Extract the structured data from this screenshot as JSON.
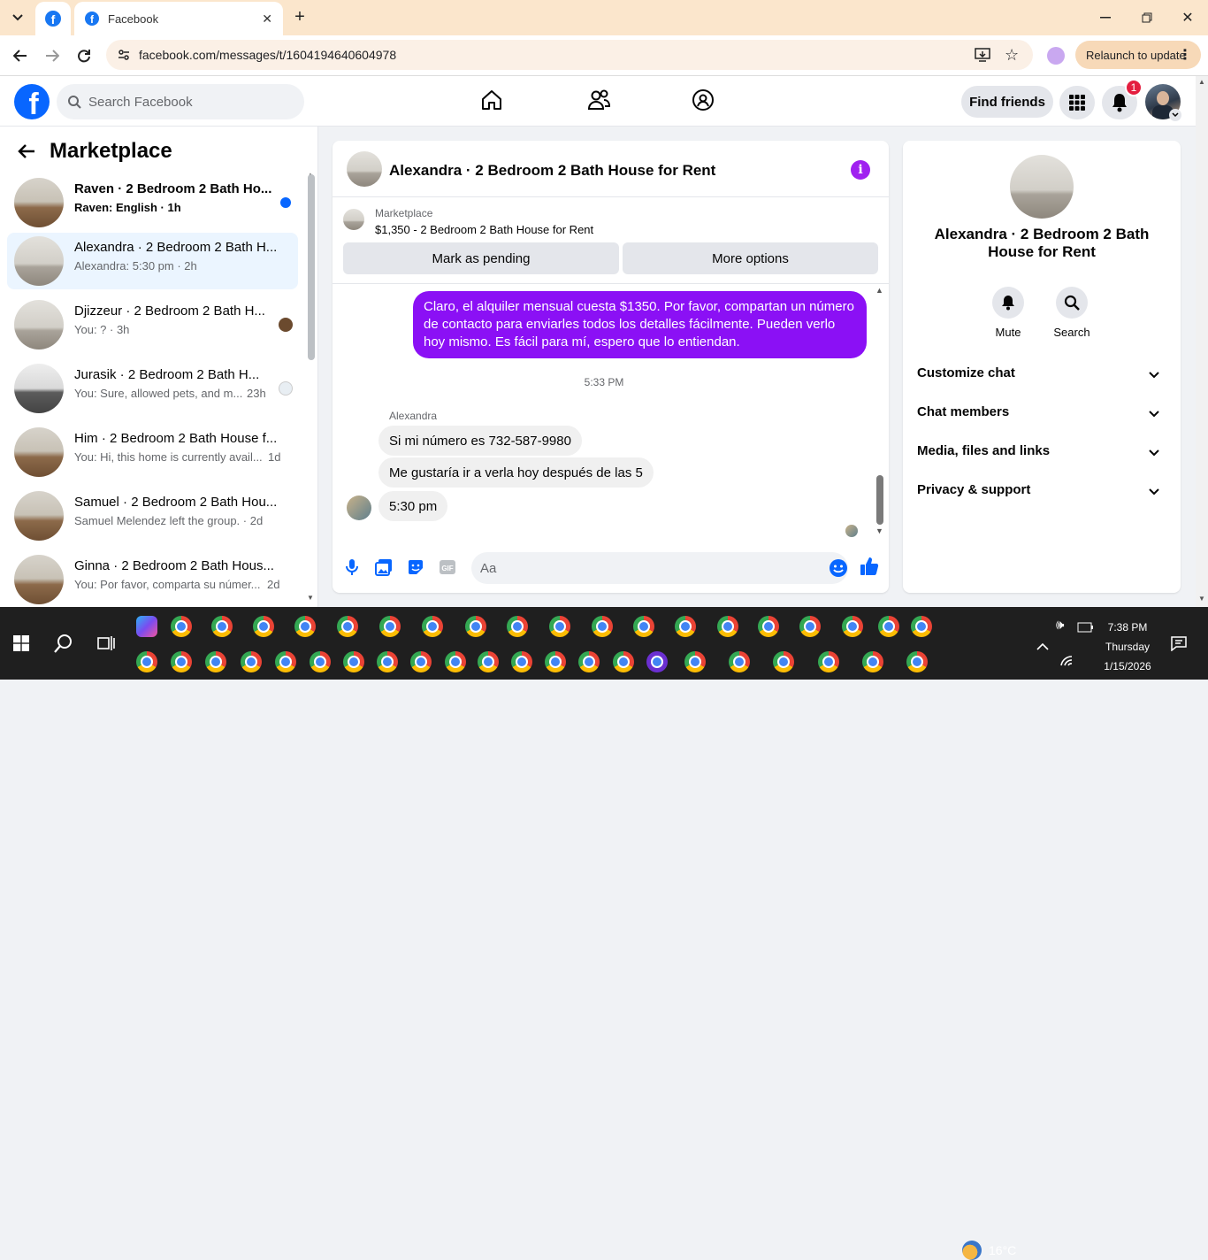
{
  "browser": {
    "tab_title": "Facebook",
    "url": "facebook.com/messages/t/1604194640604978",
    "relaunch_label": "Relaunch to update"
  },
  "header": {
    "search_placeholder": "Search Facebook",
    "find_friends": "Find friends",
    "notification_count": "1"
  },
  "sidebar": {
    "title": "Marketplace",
    "conversations": [
      {
        "name": "Raven · 2 Bedroom 2 Bath Ho...",
        "sub": "Raven: English · 1h",
        "unread": true
      },
      {
        "name": "Alexandra · 2 Bedroom 2 Bath H...",
        "sub": "Alexandra: 5:30 pm · 2h",
        "active": true
      },
      {
        "name": "Djizzeur · 2 Bedroom 2 Bath H...",
        "sub": "You: ? · 3h"
      },
      {
        "name": "Jurasik · 2 Bedroom 2 Bath H...",
        "sub": "You: Sure, allowed pets, and m...",
        "time": "23h"
      },
      {
        "name": "Him · 2 Bedroom 2 Bath House f...",
        "sub": "You: Hi, this home is currently avail...",
        "time": "1d"
      },
      {
        "name": "Samuel · 2 Bedroom 2 Bath Hou...",
        "sub": "Samuel Melendez left the group. · 2d"
      },
      {
        "name": "Ginna · 2 Bedroom 2 Bath Hous...",
        "sub": "You: Por favor, comparta su númer...",
        "time": "2d"
      }
    ]
  },
  "chat": {
    "title": "Alexandra · 2 Bedroom 2 Bath House for Rent",
    "marketplace_label": "Marketplace",
    "listing": "$1,350 - 2 Bedroom 2 Bath House for Rent",
    "mark_pending": "Mark as pending",
    "more_options": "More options",
    "sent_message": "Claro, el alquiler mensual cuesta $1350. Por favor, compartan un número de contacto para enviarles todos los detalles fácilmente. Pueden verlo hoy mismo. Es fácil para mí, espero que lo entiendan.",
    "time_separator": "5:33 PM",
    "sender_name": "Alexandra",
    "received": [
      "Si mi número es 732-587-9980",
      "Me gustaría ir a verla hoy después de las 5",
      "5:30 pm"
    ],
    "composer_placeholder": "Aa"
  },
  "details": {
    "title": "Alexandra · 2 Bedroom 2 Bath House for Rent",
    "mute": "Mute",
    "search": "Search",
    "sections": [
      "Customize chat",
      "Chat members",
      "Media, files and links",
      "Privacy & support"
    ]
  },
  "taskbar": {
    "temperature": "16°C",
    "time": "7:38 PM",
    "day": "Thursday",
    "date": "1/15/2026"
  },
  "colors": {
    "fb_blue": "#0866ff",
    "sent_bubble": "#8b10f5",
    "info_icon": "#a020f0"
  }
}
